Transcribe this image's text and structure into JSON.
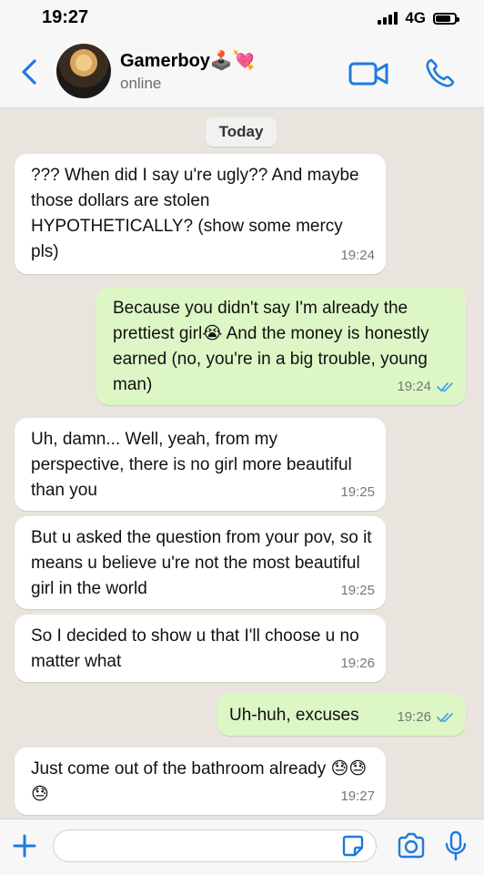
{
  "status_bar": {
    "time": "19:27",
    "network": "4G"
  },
  "header": {
    "contact_name": "Gamerboy🕹️💘",
    "contact_status": "online"
  },
  "colors": {
    "accent": "#1f7ae0",
    "incoming_bubble": "#ffffff",
    "outgoing_bubble": "#dcf7c5",
    "read_tick": "#4fa3e0"
  },
  "chat": {
    "date_label": "Today",
    "messages": [
      {
        "direction": "in",
        "text": "??? When did I say u're ugly?? And maybe those dollars are stolen HYPOTHETICALLY? (show some mercy pls)",
        "time": "19:24"
      },
      {
        "direction": "out",
        "text": "Because you didn't say I'm already the prettiest girl😭 And the money is honestly earned (no, you're in a big trouble, young man)",
        "time": "19:24",
        "read": true
      },
      {
        "direction": "in",
        "text": "Uh, damn... Well, yeah, from my perspective, there is no girl more beautiful than you",
        "time": "19:25"
      },
      {
        "direction": "in",
        "text": "But u asked the question from your pov, so it means u believe u're not the most beautiful girl in the world",
        "time": "19:25"
      },
      {
        "direction": "in",
        "text": "So I decided to show u that I'll choose u no matter what",
        "time": "19:26"
      },
      {
        "direction": "out",
        "text": "Uh-huh, excuses",
        "time": "19:26",
        "read": true
      },
      {
        "direction": "in",
        "text": "Just come out of the bathroom already 😓😓😓",
        "time": "19:27"
      }
    ]
  },
  "input": {
    "placeholder": ""
  },
  "icons": [
    "back-chevron-icon",
    "video-call-icon",
    "phone-icon",
    "plus-icon",
    "sticker-icon",
    "camera-icon",
    "microphone-icon",
    "double-check-icon"
  ]
}
